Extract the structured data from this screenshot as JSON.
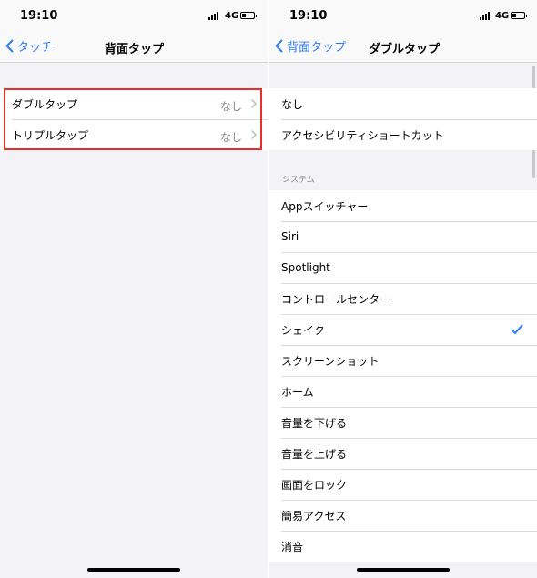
{
  "left": {
    "status": {
      "time": "19:10",
      "network": "4G"
    },
    "nav": {
      "back_label": "タッチ",
      "title": "背面タップ"
    },
    "rows": [
      {
        "label": "ダブルタップ",
        "value": "なし"
      },
      {
        "label": "トリプルタップ",
        "value": "なし"
      }
    ],
    "highlight_color": "#e53127"
  },
  "right": {
    "status": {
      "time": "19:10",
      "network": "4G"
    },
    "nav": {
      "back_label": "背面タップ",
      "title": "ダブルタップ"
    },
    "top_group": [
      {
        "label": "なし"
      },
      {
        "label": "アクセシビリティショートカット"
      }
    ],
    "section_header": "システム",
    "system_group": [
      {
        "label": "Appスイッチャー"
      },
      {
        "label": "Siri"
      },
      {
        "label": "Spotlight"
      },
      {
        "label": "コントロールセンター"
      },
      {
        "label": "シェイク",
        "checked": true
      },
      {
        "label": "スクリーンショット"
      },
      {
        "label": "ホーム"
      },
      {
        "label": "音量を下げる"
      },
      {
        "label": "音量を上げる"
      },
      {
        "label": "画面をロック"
      },
      {
        "label": "簡易アクセス"
      },
      {
        "label": "消音"
      }
    ]
  },
  "colors": {
    "accent": "#2f7cf6",
    "background": "#f2f2f7",
    "highlight": "#e53127"
  }
}
